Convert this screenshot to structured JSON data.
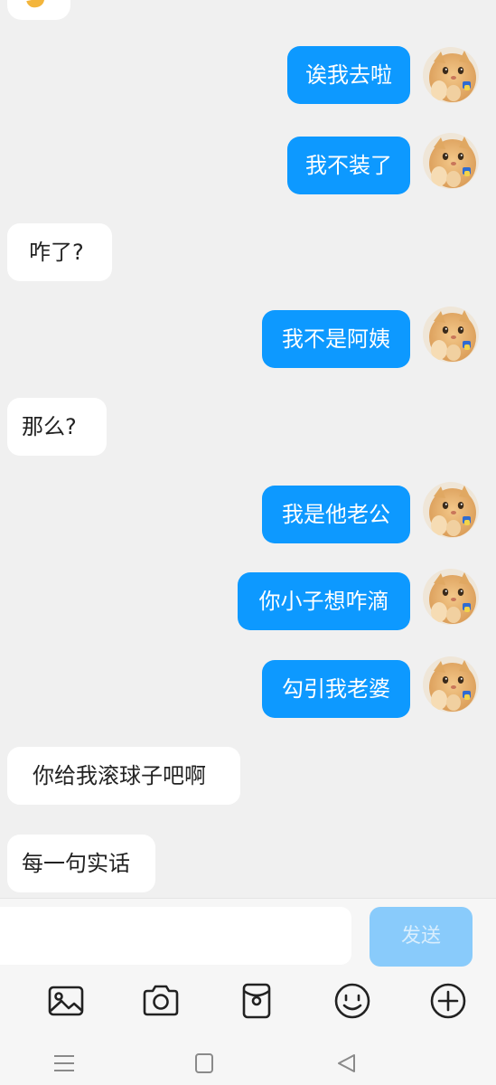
{
  "colors": {
    "background": "#f0f0f0",
    "outgoing_bubble": "#0d99ff",
    "incoming_bubble": "#ffffff",
    "send_button_disabled": "#89cbfb",
    "icon": "#222222"
  },
  "messages": [
    {
      "direction": "outgoing",
      "text": "诶我去啦"
    },
    {
      "direction": "outgoing",
      "text": "我不装了"
    },
    {
      "direction": "incoming",
      "text": "咋了?"
    },
    {
      "direction": "outgoing",
      "text": "我不是阿姨"
    },
    {
      "direction": "incoming",
      "text": "那么?"
    },
    {
      "direction": "outgoing",
      "text": "我是他老公"
    },
    {
      "direction": "outgoing",
      "text": "你小子想咋滴"
    },
    {
      "direction": "outgoing",
      "text": "勾引我老婆"
    },
    {
      "direction": "incoming",
      "text": "你给我滚球子吧啊"
    },
    {
      "direction": "incoming",
      "text": "每一句实话"
    }
  ],
  "input": {
    "value": "",
    "send_label": "发送"
  },
  "toolbar": {
    "icons": [
      "image-icon",
      "camera-icon",
      "red-packet-icon",
      "emoji-icon",
      "plus-icon"
    ]
  },
  "nav": {
    "icons": [
      "menu-icon",
      "home-icon",
      "back-icon"
    ]
  }
}
